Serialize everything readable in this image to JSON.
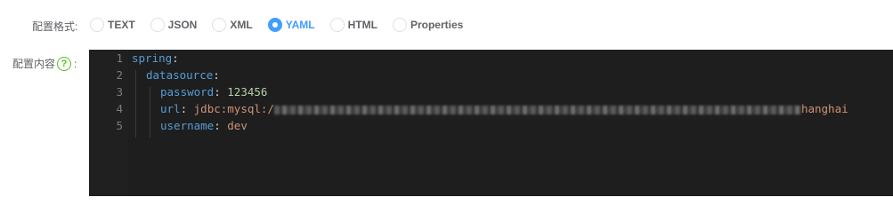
{
  "format_row": {
    "label": "配置格式:",
    "options": [
      {
        "label": "TEXT",
        "checked": false
      },
      {
        "label": "JSON",
        "checked": false
      },
      {
        "label": "XML",
        "checked": false
      },
      {
        "label": "YAML",
        "checked": true
      },
      {
        "label": "HTML",
        "checked": false
      },
      {
        "label": "Properties",
        "checked": false
      }
    ]
  },
  "content_row": {
    "label": "配置内容",
    "help_icon": "question-circle-icon",
    "suffix": ":"
  },
  "editor": {
    "lines": [
      {
        "no": "1",
        "key": "spring",
        "sep": ":",
        "value": ""
      },
      {
        "no": "2",
        "key": "datasource",
        "sep": ":",
        "value": ""
      },
      {
        "no": "3",
        "key": "password",
        "sep": ": ",
        "value": "123456"
      },
      {
        "no": "4",
        "key": "url",
        "sep": ": ",
        "value": "jdbc:mysql:/",
        "value_tail": "hanghai"
      },
      {
        "no": "5",
        "key": "username",
        "sep": ": ",
        "value": "dev"
      }
    ]
  },
  "colors": {
    "accent": "#409eff",
    "help_icon": "#52c41a",
    "editor_bg": "#1e1e1e"
  }
}
